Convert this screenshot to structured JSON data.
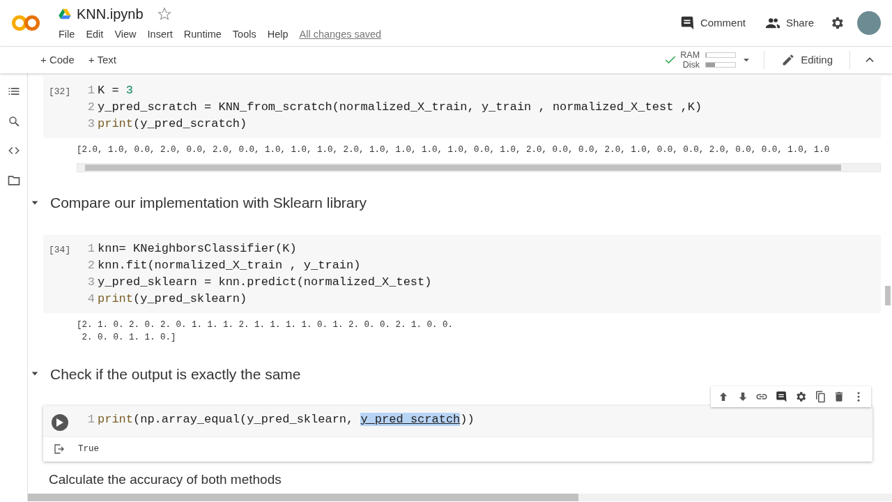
{
  "header": {
    "title": "KNN.ipynb",
    "starred": false,
    "menu": [
      "File",
      "Edit",
      "View",
      "Insert",
      "Runtime",
      "Tools",
      "Help"
    ],
    "save_status": "All changes saved",
    "actions": [
      {
        "kind": "comment",
        "label": "Comment"
      },
      {
        "kind": "share",
        "label": "Share"
      }
    ]
  },
  "toolbar": {
    "add": [
      "+ Code",
      "+ Text"
    ],
    "connected": true,
    "ram": {
      "label": "RAM",
      "level": 0.03
    },
    "disk": {
      "label": "Disk",
      "level": 0.3
    },
    "mode": "Editing"
  },
  "cells": [
    {
      "kind": "code",
      "active": false,
      "count": "[32]",
      "lines": [
        {
          "n": "1",
          "code": [
            {
              "t": "K = "
            },
            {
              "t": "3",
              "kind": "number"
            }
          ]
        },
        {
          "n": "2",
          "code": [
            {
              "t": "y_pred_scratch = KNN_from_scratch(normalized_X_train, y_train , normalized_X_test ,K)"
            }
          ]
        },
        {
          "n": "3",
          "code": [
            {
              "t": "print",
              "kind": "builtin"
            },
            {
              "t": "(y_pred_scratch)"
            }
          ]
        }
      ],
      "output": {
        "scroll": true,
        "lines": [
          "[2.0, 1.0, 0.0, 2.0, 0.0, 2.0, 0.0, 1.0, 1.0, 1.0, 2.0, 1.0, 1.0, 1.0, 1.0, 0.0, 1.0, 2.0, 0.0, 0.0, 2.0, 1.0, 0.0, 0.0, 2.0, 0.0, 0.0, 1.0, 1.0"
        ]
      }
    },
    {
      "kind": "heading",
      "expanded": true,
      "text": "Compare our implementation with Sklearn library"
    },
    {
      "kind": "code",
      "active": false,
      "count": "[34]",
      "lines": [
        {
          "n": "1",
          "code": [
            {
              "t": "knn= KNeighborsClassifier(K)"
            }
          ]
        },
        {
          "n": "2",
          "code": [
            {
              "t": "knn.fit(normalized_X_train , y_train)"
            }
          ]
        },
        {
          "n": "3",
          "code": [
            {
              "t": "y_pred_sklearn = knn.predict(normalized_X_test)"
            }
          ]
        },
        {
          "n": "4",
          "code": [
            {
              "t": "print",
              "kind": "builtin"
            },
            {
              "t": "(y_pred_sklearn)"
            }
          ]
        }
      ],
      "output": {
        "scroll": false,
        "lines": [
          "[2. 1. 0. 2. 0. 2. 0. 1. 1. 1. 2. 1. 1. 1. 1. 0. 1. 2. 0. 0. 2. 1. 0. 0.",
          " 2. 0. 0. 1. 1. 0.]"
        ]
      }
    },
    {
      "kind": "heading",
      "expanded": true,
      "text": "Check if the output is exactly the same"
    },
    {
      "kind": "code",
      "active": true,
      "lines": [
        {
          "n": "1",
          "code": [
            {
              "t": "print",
              "kind": "builtin"
            },
            {
              "t": "(np.array_equal(y_pred_sklearn, "
            },
            {
              "t": "y_pred_scratch",
              "kind": "selected"
            },
            {
              "t": "))"
            }
          ]
        }
      ],
      "output": {
        "lines": [
          "True"
        ]
      }
    },
    {
      "kind": "text",
      "text": "Calculate the accuracy of both methods"
    }
  ]
}
